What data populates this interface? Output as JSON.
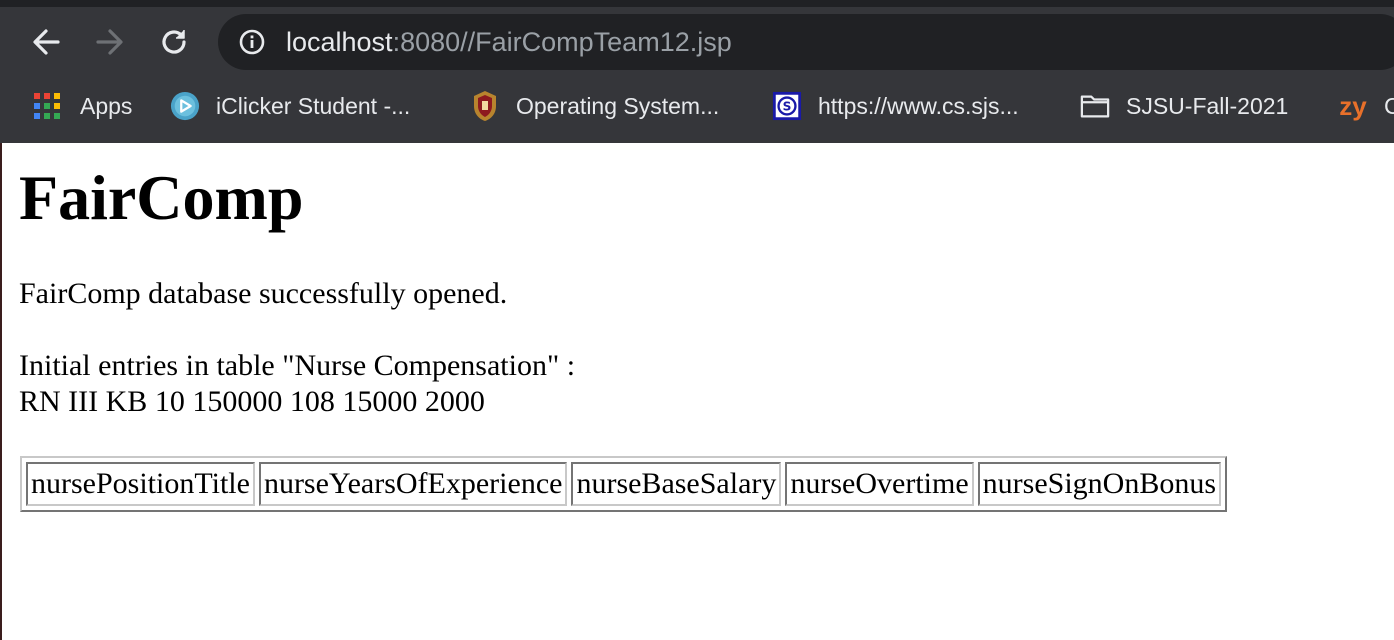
{
  "browser": {
    "url_host": "localhost",
    "url_rest": ":8080//FairCompTeam12.jsp",
    "bookmarks": [
      {
        "label": "Apps",
        "icon": "apps-grid-icon"
      },
      {
        "label": "iClicker Student -...",
        "icon": "iclicker-icon"
      },
      {
        "label": "Operating System...",
        "icon": "university-seal-icon"
      },
      {
        "label": "https://www.cs.sjs...",
        "icon": "cs-site-icon"
      },
      {
        "label": "SJSU-Fall-2021",
        "icon": "folder-icon"
      },
      {
        "label": "C",
        "icon": "zybooks-icon",
        "icon_text": "zy"
      }
    ],
    "colors": {
      "toolbar": "#35363a",
      "omnibox": "#202124",
      "text": "#e8eaed",
      "muted": "#9aa0a6"
    }
  },
  "page": {
    "title": "FairComp",
    "status": "FairComp database successfully opened.",
    "entries_heading": "Initial entries in table \"Nurse Compensation\" :",
    "entry_row": "RN III KB 10 150000 108 15000 2000",
    "table_headers": [
      "nursePositionTitle",
      "nurseYearsOfExperience",
      "nurseBaseSalary",
      "nurseOvertime",
      "nurseSignOnBonus"
    ]
  }
}
